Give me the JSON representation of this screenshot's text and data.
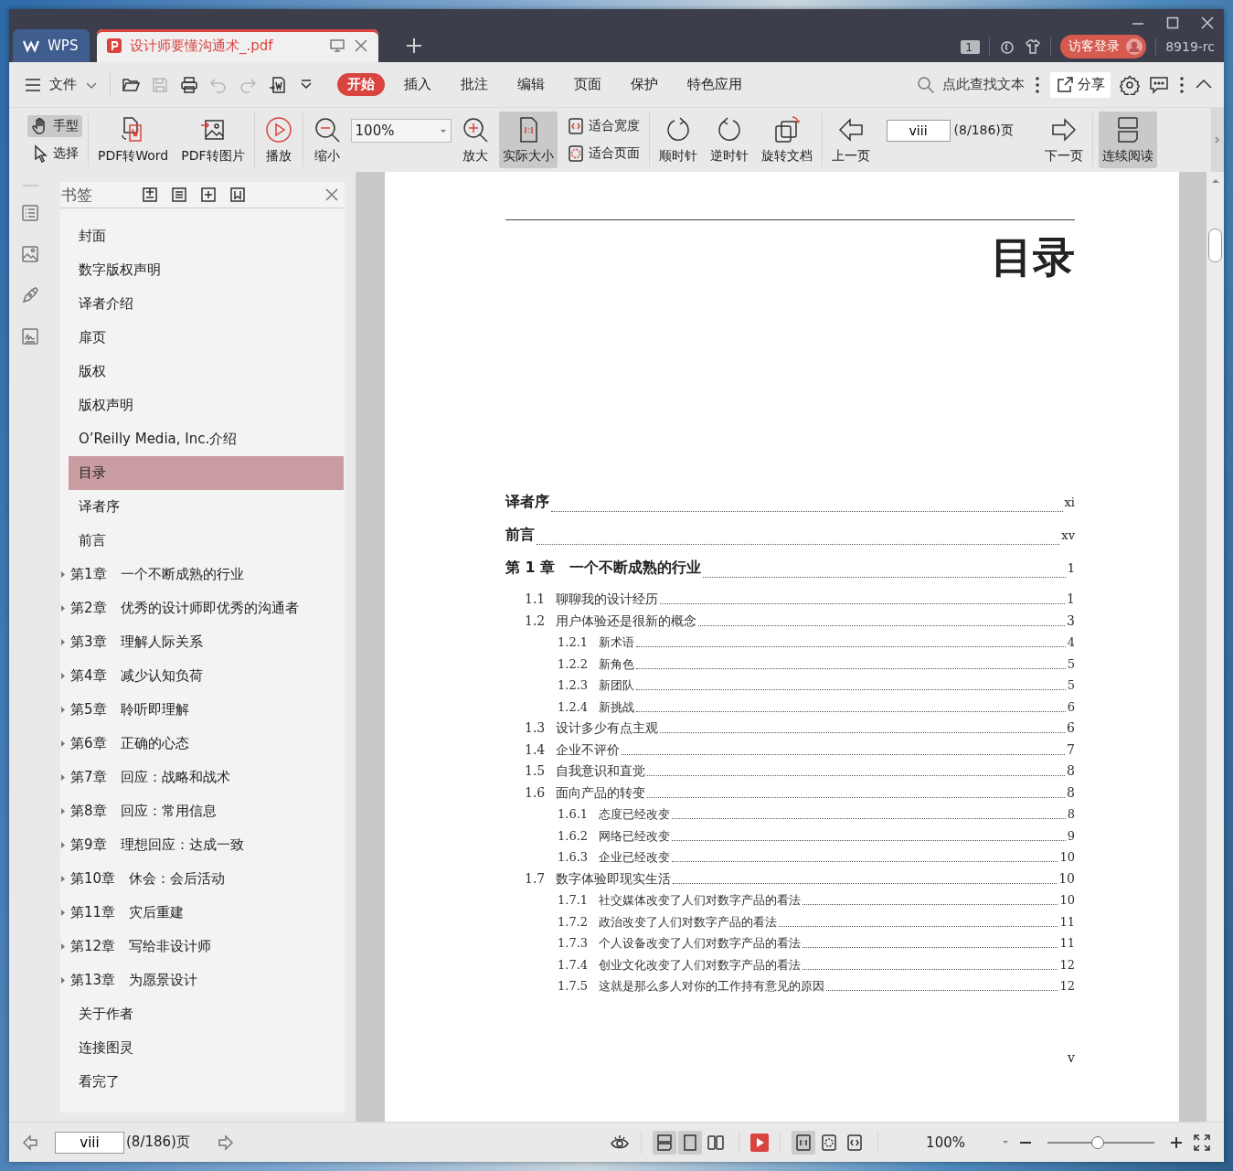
{
  "window": {
    "tabs": [
      {
        "kind": "home",
        "label": "WPS",
        "selected": false
      },
      {
        "kind": "pdf",
        "label": "设计师要懂沟通术_.pdf",
        "selected": true
      }
    ],
    "page_count_badge": "1",
    "login_button": "访客登录",
    "user_name": "8919-rc"
  },
  "menu": {
    "file_menu": "文件",
    "quick_actions": [
      {
        "kind": "open",
        "disabled": false
      },
      {
        "kind": "save",
        "disabled": true
      },
      {
        "kind": "print",
        "disabled": false
      },
      {
        "kind": "undo",
        "disabled": true
      },
      {
        "kind": "redo",
        "disabled": true
      },
      {
        "kind": "export",
        "disabled": false
      },
      {
        "kind": "more",
        "disabled": false
      }
    ],
    "tabs": [
      {
        "label": "开始",
        "selected": true
      },
      {
        "label": "插入",
        "selected": false
      },
      {
        "label": "批注",
        "selected": false
      },
      {
        "label": "编辑",
        "selected": false
      },
      {
        "label": "页面",
        "selected": false
      },
      {
        "label": "保护",
        "selected": false
      },
      {
        "label": "特色应用",
        "selected": false
      }
    ],
    "search": {
      "label": "点此查找文本"
    },
    "share_button": "分享"
  },
  "ribbon": {
    "groups": [
      {
        "items": [
          {
            "kind": "stack",
            "items": [
              {
                "kind": "hand",
                "label": "手型",
                "selected": true
              },
              {
                "kind": "select",
                "label": "选择",
                "selected": false
              }
            ]
          }
        ]
      },
      {
        "items": [
          {
            "kind": "pdf-word",
            "label": "PDF转Word",
            "selected": false
          },
          {
            "kind": "pdf-image",
            "label": "PDF转图片",
            "selected": false
          }
        ]
      },
      {
        "items": [
          {
            "kind": "play",
            "label": "播放",
            "selected": false
          }
        ]
      },
      {
        "items": [
          {
            "kind": "zoom-out",
            "label": "缩小",
            "selected": false
          },
          {
            "kind": "zoom-field",
            "value": "100%"
          },
          {
            "kind": "zoom-in",
            "label": "放大",
            "selected": false
          },
          {
            "kind": "actual-size",
            "label": "实际大小",
            "selected": true
          },
          {
            "kind": "stack",
            "items": [
              {
                "kind": "fit-width",
                "label": "适合宽度",
                "selected": false
              },
              {
                "kind": "fit-page",
                "label": "适合页面",
                "selected": false
              }
            ]
          }
        ]
      },
      {
        "items": [
          {
            "kind": "rotate-cw",
            "label": "顺时针",
            "selected": false
          },
          {
            "kind": "rotate-ccw",
            "label": "逆时针",
            "selected": false
          },
          {
            "kind": "rotate-doc",
            "label": "旋转文档",
            "selected": false
          }
        ]
      },
      {
        "items": [
          {
            "kind": "prev",
            "label": "上一页",
            "selected": false
          },
          {
            "kind": "page-field",
            "value": "viii",
            "total": "(8/186)页"
          },
          {
            "kind": "next",
            "label": "下一页",
            "selected": false
          }
        ]
      },
      {
        "items": [
          {
            "kind": "continuous",
            "label": "连续阅读",
            "selected": true
          }
        ]
      }
    ]
  },
  "bookmarks": {
    "title": "书签",
    "items": [
      {
        "label": "封面",
        "kind": "leaf",
        "selected": false
      },
      {
        "label": "数字版权声明",
        "kind": "leaf",
        "selected": false
      },
      {
        "label": "译者介绍",
        "kind": "leaf",
        "selected": false
      },
      {
        "label": "扉页",
        "kind": "leaf",
        "selected": false
      },
      {
        "label": "版权",
        "kind": "leaf",
        "selected": false
      },
      {
        "label": "版权声明",
        "kind": "leaf",
        "selected": false
      },
      {
        "label": "O’Reilly Media, Inc.介绍",
        "kind": "leaf",
        "selected": false
      },
      {
        "label": "目录",
        "kind": "leaf",
        "selected": true
      },
      {
        "label": "译者序",
        "kind": "leaf",
        "selected": false
      },
      {
        "label": "前言",
        "kind": "leaf",
        "selected": false
      },
      {
        "label": "第1章　一个不断成熟的行业",
        "kind": "folder",
        "selected": false
      },
      {
        "label": "第2章　优秀的设计师即优秀的沟通者",
        "kind": "folder",
        "selected": false
      },
      {
        "label": "第3章　理解人际关系",
        "kind": "folder",
        "selected": false
      },
      {
        "label": "第4章　减少认知负荷",
        "kind": "folder",
        "selected": false
      },
      {
        "label": "第5章　聆听即理解",
        "kind": "folder",
        "selected": false
      },
      {
        "label": "第6章　正确的心态",
        "kind": "folder",
        "selected": false
      },
      {
        "label": "第7章　回应：战略和战术",
        "kind": "folder",
        "selected": false
      },
      {
        "label": "第8章　回应：常用信息",
        "kind": "folder",
        "selected": false
      },
      {
        "label": "第9章　理想回应：达成一致",
        "kind": "folder",
        "selected": false
      },
      {
        "label": "第10章　休会：会后活动",
        "kind": "folder",
        "selected": false
      },
      {
        "label": "第11章　灾后重建",
        "kind": "folder",
        "selected": false
      },
      {
        "label": "第12章　写给非设计师",
        "kind": "folder",
        "selected": false
      },
      {
        "label": "第13章　为愿景设计",
        "kind": "folder",
        "selected": false
      },
      {
        "label": "关于作者",
        "kind": "leaf",
        "selected": false
      },
      {
        "label": "连接图灵",
        "kind": "leaf",
        "selected": false
      },
      {
        "label": "看完了",
        "kind": "leaf",
        "selected": false
      }
    ]
  },
  "page": {
    "title": "目录",
    "toc": [
      {
        "title": "译者序",
        "page": "xi"
      },
      {
        "title": "前言",
        "page": "xv"
      },
      {
        "number": "第 1 章",
        "title": "一个不断成熟的行业",
        "page": "1",
        "children": [
          {
            "number": "1.1",
            "title": "聊聊我的设计经历",
            "page": "1"
          },
          {
            "number": "1.2",
            "title": "用户体验还是很新的概念",
            "page": "3",
            "children": [
              {
                "number": "1.2.1",
                "title": "新术语",
                "page": "4"
              },
              {
                "number": "1.2.2",
                "title": "新角色",
                "page": "5"
              },
              {
                "number": "1.2.3",
                "title": "新团队",
                "page": "5"
              },
              {
                "number": "1.2.4",
                "title": "新挑战",
                "page": "6"
              }
            ]
          },
          {
            "number": "1.3",
            "title": "设计多少有点主观",
            "page": "6"
          },
          {
            "number": "1.4",
            "title": "企业不评价",
            "page": "7"
          },
          {
            "number": "1.5",
            "title": "自我意识和直觉",
            "page": "8"
          },
          {
            "number": "1.6",
            "title": "面向产品的转变",
            "page": "8",
            "children": [
              {
                "number": "1.6.1",
                "title": "态度已经改变",
                "page": "8"
              },
              {
                "number": "1.6.2",
                "title": "网络已经改变",
                "page": "9"
              },
              {
                "number": "1.6.3",
                "title": "企业已经改变",
                "page": "10"
              }
            ]
          },
          {
            "number": "1.7",
            "title": "数字体验即现实生活",
            "page": "10",
            "children": [
              {
                "number": "1.7.1",
                "title": "社交媒体改变了人们对数字产品的看法",
                "page": "10"
              },
              {
                "number": "1.7.2",
                "title": "政治改变了人们对数字产品的看法",
                "page": "11"
              },
              {
                "number": "1.7.3",
                "title": "个人设备改变了人们对数字产品的看法",
                "page": "11"
              },
              {
                "number": "1.7.4",
                "title": "创业文化改变了人们对数字产品的看法",
                "page": "12"
              },
              {
                "number": "1.7.5",
                "title": "这就是那么多人对你的工作持有意见的原因",
                "page": "12"
              }
            ]
          }
        ]
      }
    ],
    "footer": "v"
  },
  "status_bar": {
    "page_value": "viii",
    "page_total": "(8/186)页",
    "view_modes": [
      {
        "kind": "double",
        "selected": true
      },
      {
        "kind": "single",
        "selected": true
      },
      {
        "kind": "book",
        "selected": false
      }
    ],
    "fit_modes": [
      {
        "kind": "actual",
        "selected": true
      },
      {
        "kind": "fit-page",
        "selected": false
      },
      {
        "kind": "fit-width",
        "selected": false
      }
    ],
    "zoom": "100%",
    "zoom_slider": {
      "level": 0.47
    }
  }
}
